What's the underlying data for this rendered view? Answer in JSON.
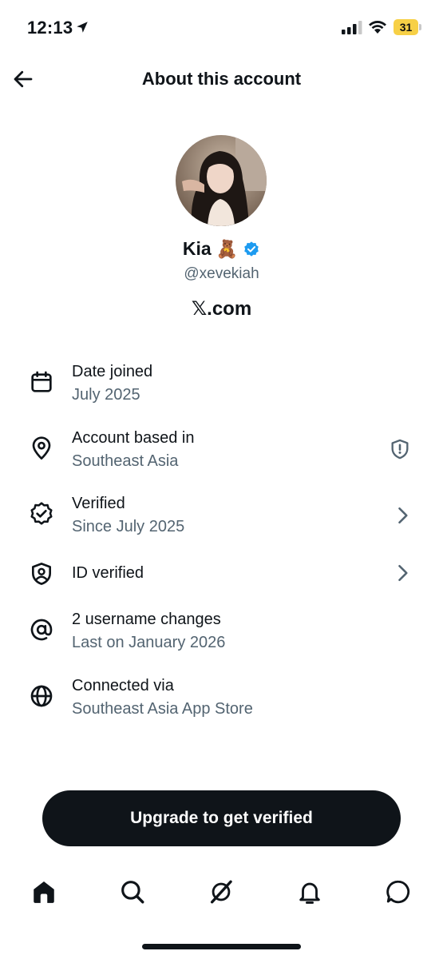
{
  "status_bar": {
    "time": "12:13",
    "battery_level": "31",
    "battery_color": "#f7d046",
    "icons": [
      "location-arrow-icon",
      "signal-icon",
      "wifi-icon",
      "battery-icon"
    ]
  },
  "header": {
    "title": "About this account",
    "back_icon": "arrow-left-icon"
  },
  "profile": {
    "display_name": "Kia",
    "name_emoji": "🧸",
    "verified_badge_color": "#1d9bf0",
    "handle": "@xevekiah",
    "site": "𝕏.com"
  },
  "info_items": [
    {
      "icon": "calendar-icon",
      "title": "Date joined",
      "subtitle": "July 2025"
    },
    {
      "icon": "location-pin-icon",
      "title": "Account based in",
      "subtitle": "Southeast Asia",
      "trailing_icon": "shield-alert-icon"
    },
    {
      "icon": "verified-check-icon",
      "title": "Verified",
      "subtitle": "Since July 2025",
      "trailing_icon": "chevron-right-icon"
    },
    {
      "icon": "id-shield-icon",
      "title": "ID verified",
      "trailing_icon": "chevron-right-icon"
    },
    {
      "icon": "at-sign-icon",
      "title": "2 username changes",
      "subtitle": "Last on January 2026"
    },
    {
      "icon": "globe-icon",
      "title": "Connected via",
      "subtitle": "Southeast Asia App Store"
    }
  ],
  "upgrade_button": {
    "label": "Upgrade to get verified"
  },
  "bottom_nav": [
    "home-icon",
    "search-icon",
    "grok-icon",
    "notifications-bell-icon",
    "messages-icon"
  ],
  "colors": {
    "text_primary": "#0f1419",
    "text_secondary": "#536471",
    "button_bg": "#0f1419"
  }
}
